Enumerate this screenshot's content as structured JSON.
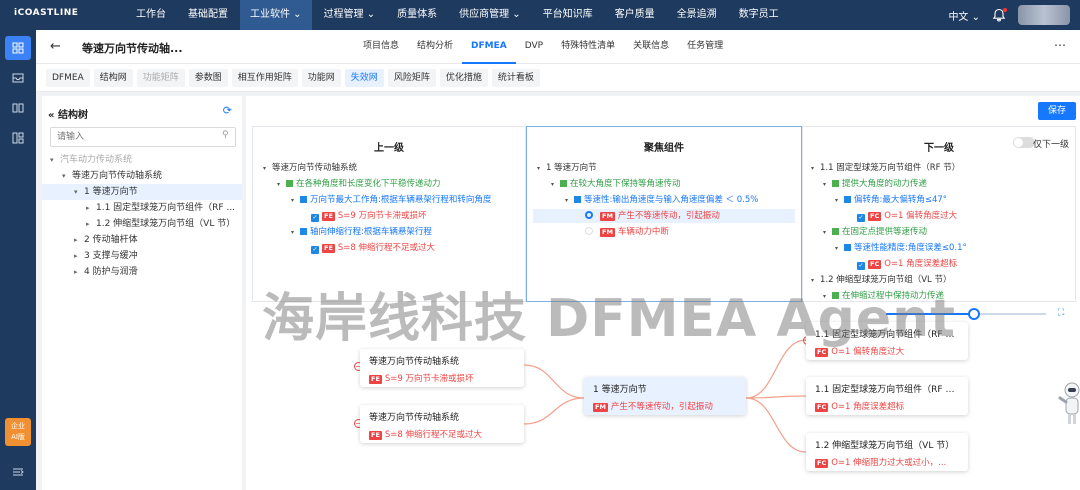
{
  "app": {
    "logo": "iCOASTLINE"
  },
  "topnav": {
    "items": [
      "工作台",
      "基础配置",
      "工业软件 ⌄",
      "过程管理 ⌄",
      "质量体系",
      "供应商管理 ⌄",
      "平台知识库",
      "客户质量",
      "全景追溯",
      "数字员工"
    ],
    "active_index": 2
  },
  "topright": {
    "language": "中文 ⌄"
  },
  "rail": {
    "ai_label_line1": "企业",
    "ai_label_line2": "AI版"
  },
  "header": {
    "title": "等速万向节传动轴...",
    "tabs": [
      "项目信息",
      "结构分析",
      "DFMEA",
      "DVP",
      "特殊特性清单",
      "关联信息",
      "任务管理"
    ],
    "active_tab": 2
  },
  "subtabs": {
    "items": [
      "DFMEA",
      "结构网",
      "功能矩阵",
      "参数图",
      "相互作用矩阵",
      "功能网",
      "失效网",
      "风险矩阵",
      "优化措施",
      "统计看板"
    ],
    "active": 6,
    "dim": [
      2
    ]
  },
  "sidebar": {
    "title": "结构树",
    "search_placeholder": "请输入",
    "tree": [
      {
        "label": "汽车动力传动系统",
        "level": 0,
        "arrow": "▾",
        "dim": true
      },
      {
        "label": "等速万向节传动轴系统",
        "level": 1,
        "arrow": "▾"
      },
      {
        "label": "1 等速万向节",
        "level": 2,
        "arrow": "▾",
        "selected": true
      },
      {
        "label": "1.1 固定型球笼万向节组件（RF ...",
        "level": 3,
        "arrow": "▸"
      },
      {
        "label": "1.2 伸缩型球笼万向节组（VL 节）",
        "level": 3,
        "arrow": "▸"
      },
      {
        "label": "2 传动轴杆体",
        "level": 2,
        "arrow": "▸"
      },
      {
        "label": "3 支撑与缓冲",
        "level": 2,
        "arrow": "▸"
      },
      {
        "label": "4 防护与润滑",
        "level": 2,
        "arrow": "▸"
      }
    ]
  },
  "toolbar": {
    "save_label": "保存"
  },
  "panels": {
    "upper": {
      "title": "上一级",
      "rows": [
        "等速万向节传动轴系统",
        "在各种角度和长度变化下平稳传递动力",
        "万向节最大工作角:根据车辆悬架行程和转向角度",
        "S=9 万向节卡滞或损坏",
        "轴向伸缩行程:根据车辆悬架行程",
        "S=8 伸缩行程不足或过大"
      ],
      "badges": [
        "FE",
        "FE"
      ]
    },
    "focus": {
      "title": "聚焦组件",
      "rows": [
        "1 等速万向节",
        "在较大角度下保持等角速传动",
        "等速性:输出角速度与输入角速度偏差 ＜ 0.5%",
        "产生不等速传动，引起振动",
        "车辆动力中断"
      ],
      "badges": [
        "FM",
        "FM"
      ]
    },
    "lower": {
      "title": "下一级",
      "toggle_label": "仅下一级",
      "rows": [
        "1.1 固定型球笼万向节组件（RF 节）",
        "提供大角度的动力传递",
        "偏转角:最大偏转角≤47°",
        "O=1 偏转角度过大",
        "在固定点提供等速传动",
        "等速性能精度:角度误差≤0.1°",
        "O=1 角度误差超标",
        "1.2 伸缩型球笼万向节组（VL 节）",
        "在伸缩过程中保持动力传递"
      ],
      "badges": [
        "FC",
        "FC"
      ]
    }
  },
  "graph": {
    "zoom_fraction": 0.55,
    "left_cards": [
      {
        "title": "等速万向节传动轴系统",
        "badge": "FE",
        "fail": "S=9 万向节卡滞或损坏"
      },
      {
        "title": "等速万向节传动轴系统",
        "badge": "FE",
        "fail": "S=8 伸缩行程不足或过大"
      }
    ],
    "center_card": {
      "title": "1 等速万向节",
      "badge": "FM",
      "fail": "产生不等速传动，引起振动"
    },
    "right_cards": [
      {
        "title": "1.1 固定型球笼万向节组件（RF 节...",
        "badge": "FC",
        "fail": "O=1 偏转角度过大"
      },
      {
        "title": "1.1 固定型球笼万向节组件（RF 节...",
        "badge": "FC",
        "fail": "O=1 角度误差超标"
      },
      {
        "title": "1.2 伸缩型球笼万向节组（VL 节）",
        "badge": "FC",
        "fail": "O=1 伸缩阻力过大或过小，..."
      }
    ]
  },
  "watermark": "海岸线科技 DFMEA Agent"
}
